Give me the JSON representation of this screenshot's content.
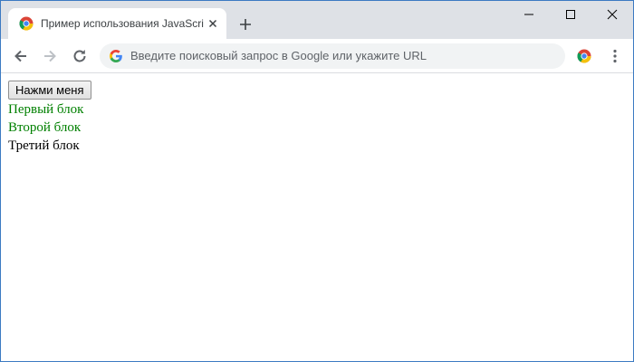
{
  "browser": {
    "tab": {
      "title": "Пример использования JavaScript",
      "favicon": "chrome-favicon-icon",
      "close_icon": "close-icon"
    },
    "new_tab_icon": "plus-icon",
    "window_controls": [
      "minimize-icon",
      "maximize-icon",
      "close-icon"
    ],
    "toolbar": {
      "back_icon": "arrow-left-icon",
      "forward_icon": "arrow-right-icon",
      "reload_icon": "reload-icon",
      "omnibox": {
        "icon": "google-g-icon",
        "placeholder": "Введите поисковый запрос в Google или укажите URL"
      },
      "extension_icon": "chrome-extension-icon",
      "menu_icon": "kebab-menu-icon"
    }
  },
  "page": {
    "button_label": "Нажми меня",
    "blocks": [
      {
        "text": "Первый блок",
        "color": "#008000"
      },
      {
        "text": "Второй блок",
        "color": "#008000"
      },
      {
        "text": "Третий блок",
        "color": "#000000"
      }
    ]
  },
  "colors": {
    "tabstrip_bg": "#dee1e6",
    "omnibox_bg": "#f1f3f4",
    "window_border": "#3c7ac2"
  }
}
